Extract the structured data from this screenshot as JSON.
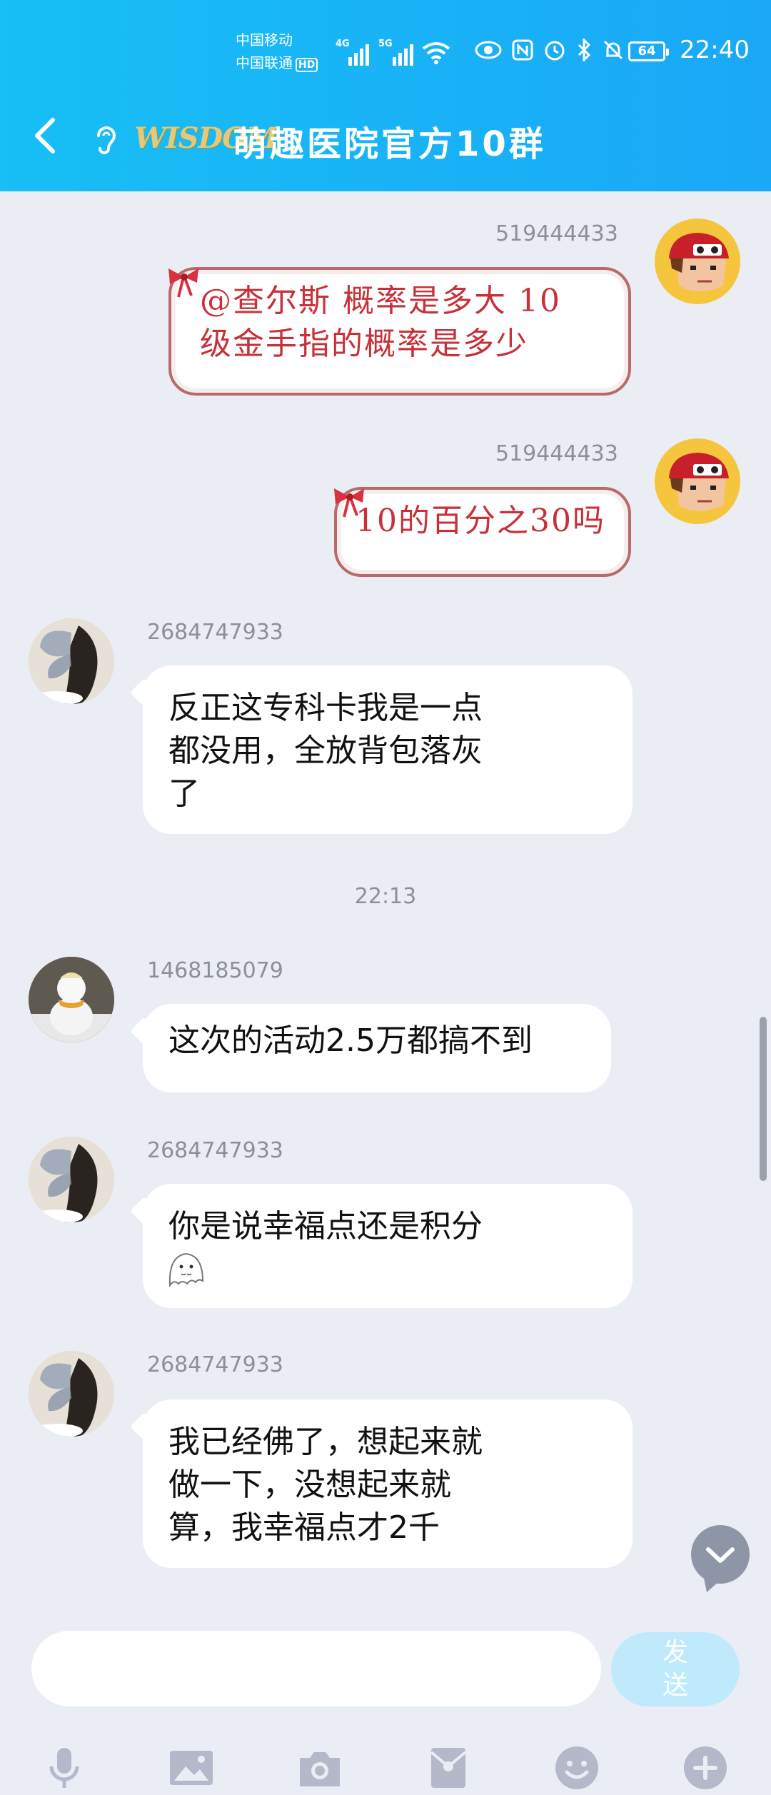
{
  "status_bar": {
    "carrier1": "中国移动",
    "carrier2": "中国联通",
    "hd": "HD",
    "net1": "4G",
    "net2": "5G",
    "battery": "64",
    "time": "22:40"
  },
  "header": {
    "logo_text": "WISDOM",
    "title": "萌趣医院官方10群"
  },
  "messages": [
    {
      "sender": "519444433",
      "text_line1": "@查尔斯 概率是多大  10",
      "text_line2": "级金手指的概率是多少"
    },
    {
      "sender": "519444433",
      "text_line1": "10的百分之30吗"
    },
    {
      "sender": "2684747933",
      "text_line1": "反正这专科卡我是一点",
      "text_line2": "都没用，全放背包落灰",
      "text_line3": "了"
    },
    {
      "time": "22:13"
    },
    {
      "sender": "1468185079",
      "text_line1": "这次的活动2.5万都搞不到"
    },
    {
      "sender": "2684747933",
      "text_line1": "你是说幸福点还是积分"
    },
    {
      "sender": "2684747933",
      "text_line1": "我已经佛了，想起来就",
      "text_line2": "做一下，没想起来就",
      "text_line3": "算，我幸福点才2千"
    }
  ],
  "input": {
    "value": "",
    "send_label_line1": "发",
    "send_label_line2": "送"
  },
  "icons": {
    "toolbar": [
      "microphone-icon",
      "image-icon",
      "camera-icon",
      "red-packet-icon",
      "emoji-icon",
      "plus-icon"
    ]
  },
  "colors": {
    "header": "#17BFF5",
    "background": "#EBEDF5",
    "send_disabled": "#BEEAFB",
    "cartoon_text": "#C8303A"
  }
}
